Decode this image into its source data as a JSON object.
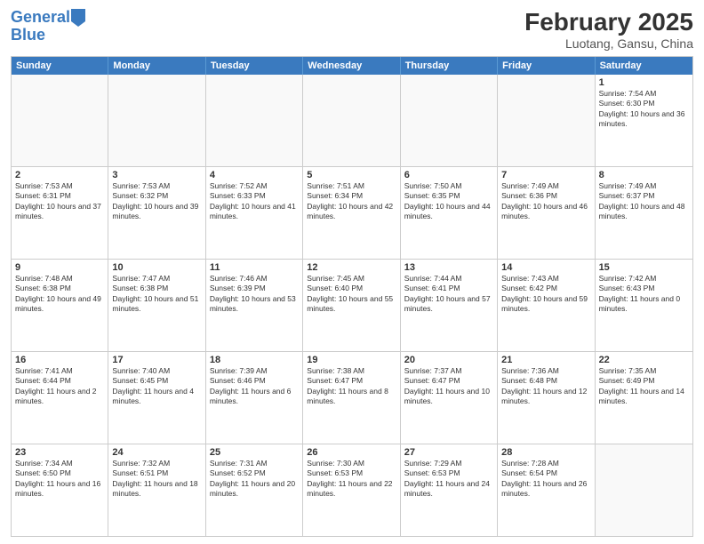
{
  "header": {
    "logo_line1": "General",
    "logo_line2": "Blue",
    "month": "February 2025",
    "location": "Luotang, Gansu, China"
  },
  "weekdays": [
    "Sunday",
    "Monday",
    "Tuesday",
    "Wednesday",
    "Thursday",
    "Friday",
    "Saturday"
  ],
  "rows": [
    [
      {
        "day": "",
        "info": ""
      },
      {
        "day": "",
        "info": ""
      },
      {
        "day": "",
        "info": ""
      },
      {
        "day": "",
        "info": ""
      },
      {
        "day": "",
        "info": ""
      },
      {
        "day": "",
        "info": ""
      },
      {
        "day": "1",
        "info": "Sunrise: 7:54 AM\nSunset: 6:30 PM\nDaylight: 10 hours and 36 minutes."
      }
    ],
    [
      {
        "day": "2",
        "info": "Sunrise: 7:53 AM\nSunset: 6:31 PM\nDaylight: 10 hours and 37 minutes."
      },
      {
        "day": "3",
        "info": "Sunrise: 7:53 AM\nSunset: 6:32 PM\nDaylight: 10 hours and 39 minutes."
      },
      {
        "day": "4",
        "info": "Sunrise: 7:52 AM\nSunset: 6:33 PM\nDaylight: 10 hours and 41 minutes."
      },
      {
        "day": "5",
        "info": "Sunrise: 7:51 AM\nSunset: 6:34 PM\nDaylight: 10 hours and 42 minutes."
      },
      {
        "day": "6",
        "info": "Sunrise: 7:50 AM\nSunset: 6:35 PM\nDaylight: 10 hours and 44 minutes."
      },
      {
        "day": "7",
        "info": "Sunrise: 7:49 AM\nSunset: 6:36 PM\nDaylight: 10 hours and 46 minutes."
      },
      {
        "day": "8",
        "info": "Sunrise: 7:49 AM\nSunset: 6:37 PM\nDaylight: 10 hours and 48 minutes."
      }
    ],
    [
      {
        "day": "9",
        "info": "Sunrise: 7:48 AM\nSunset: 6:38 PM\nDaylight: 10 hours and 49 minutes."
      },
      {
        "day": "10",
        "info": "Sunrise: 7:47 AM\nSunset: 6:38 PM\nDaylight: 10 hours and 51 minutes."
      },
      {
        "day": "11",
        "info": "Sunrise: 7:46 AM\nSunset: 6:39 PM\nDaylight: 10 hours and 53 minutes."
      },
      {
        "day": "12",
        "info": "Sunrise: 7:45 AM\nSunset: 6:40 PM\nDaylight: 10 hours and 55 minutes."
      },
      {
        "day": "13",
        "info": "Sunrise: 7:44 AM\nSunset: 6:41 PM\nDaylight: 10 hours and 57 minutes."
      },
      {
        "day": "14",
        "info": "Sunrise: 7:43 AM\nSunset: 6:42 PM\nDaylight: 10 hours and 59 minutes."
      },
      {
        "day": "15",
        "info": "Sunrise: 7:42 AM\nSunset: 6:43 PM\nDaylight: 11 hours and 0 minutes."
      }
    ],
    [
      {
        "day": "16",
        "info": "Sunrise: 7:41 AM\nSunset: 6:44 PM\nDaylight: 11 hours and 2 minutes."
      },
      {
        "day": "17",
        "info": "Sunrise: 7:40 AM\nSunset: 6:45 PM\nDaylight: 11 hours and 4 minutes."
      },
      {
        "day": "18",
        "info": "Sunrise: 7:39 AM\nSunset: 6:46 PM\nDaylight: 11 hours and 6 minutes."
      },
      {
        "day": "19",
        "info": "Sunrise: 7:38 AM\nSunset: 6:47 PM\nDaylight: 11 hours and 8 minutes."
      },
      {
        "day": "20",
        "info": "Sunrise: 7:37 AM\nSunset: 6:47 PM\nDaylight: 11 hours and 10 minutes."
      },
      {
        "day": "21",
        "info": "Sunrise: 7:36 AM\nSunset: 6:48 PM\nDaylight: 11 hours and 12 minutes."
      },
      {
        "day": "22",
        "info": "Sunrise: 7:35 AM\nSunset: 6:49 PM\nDaylight: 11 hours and 14 minutes."
      }
    ],
    [
      {
        "day": "23",
        "info": "Sunrise: 7:34 AM\nSunset: 6:50 PM\nDaylight: 11 hours and 16 minutes."
      },
      {
        "day": "24",
        "info": "Sunrise: 7:32 AM\nSunset: 6:51 PM\nDaylight: 11 hours and 18 minutes."
      },
      {
        "day": "25",
        "info": "Sunrise: 7:31 AM\nSunset: 6:52 PM\nDaylight: 11 hours and 20 minutes."
      },
      {
        "day": "26",
        "info": "Sunrise: 7:30 AM\nSunset: 6:53 PM\nDaylight: 11 hours and 22 minutes."
      },
      {
        "day": "27",
        "info": "Sunrise: 7:29 AM\nSunset: 6:53 PM\nDaylight: 11 hours and 24 minutes."
      },
      {
        "day": "28",
        "info": "Sunrise: 7:28 AM\nSunset: 6:54 PM\nDaylight: 11 hours and 26 minutes."
      },
      {
        "day": "",
        "info": ""
      }
    ]
  ]
}
